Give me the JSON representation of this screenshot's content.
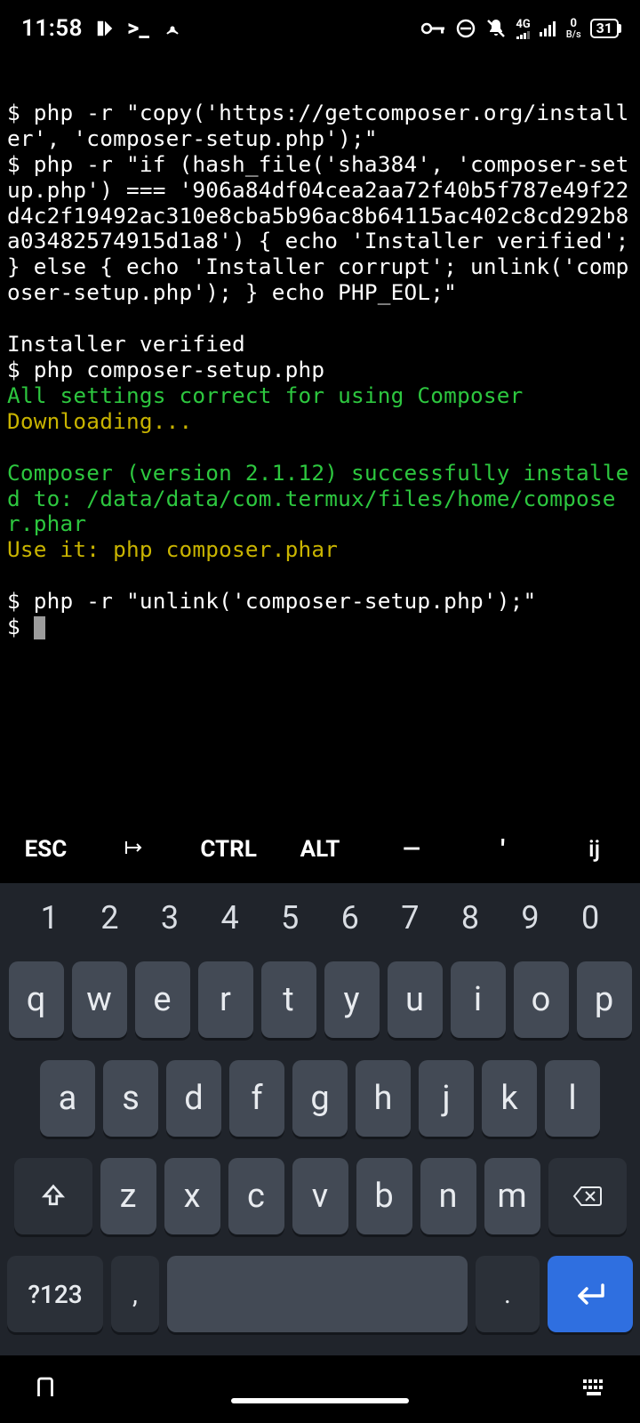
{
  "status": {
    "clock": "11:58",
    "net_label_top": "4G",
    "speed_top": "0",
    "speed_bot": "B/s",
    "battery": "31"
  },
  "term": {
    "l1": "$ php -r \"copy('https://getcomposer.org/installer', 'composer-setup.php');\"",
    "l2": "$ php -r \"if (hash_file('sha384', 'composer-setup.php') === '906a84df04cea2aa72f40b5f787e49f22d4c2f19492ac310e8cba5b96ac8b64115ac402c8cd292b8a03482574915d1a8') { echo 'Installer verified'; } else { echo 'Installer corrupt'; unlink('composer-setup.php'); } echo PHP_EOL;\"",
    "l3": "",
    "l4": "Installer verified",
    "l5": "$ php composer-setup.php",
    "l6": "All settings correct for using Composer",
    "l7": "Downloading...",
    "l8": "",
    "l9": "Composer (version 2.1.12) successfully installed to: /data/data/com.termux/files/home/composer.phar",
    "l10": "Use it: php composer.phar",
    "l11": "",
    "l12": "$ php -r \"unlink('composer-setup.php');\"",
    "l13": "$ "
  },
  "extra": {
    "esc": "ESC",
    "tab": "⇥",
    "ctrl": "CTRL",
    "alt": "ALT",
    "dash": "—",
    "apos": "'",
    "ij": "ij"
  },
  "kbd": {
    "nums": [
      "1",
      "2",
      "3",
      "4",
      "5",
      "6",
      "7",
      "8",
      "9",
      "0"
    ],
    "row1": [
      "q",
      "w",
      "e",
      "r",
      "t",
      "y",
      "u",
      "i",
      "o",
      "p"
    ],
    "row2": [
      "a",
      "s",
      "d",
      "f",
      "g",
      "h",
      "j",
      "k",
      "l"
    ],
    "row3": [
      "z",
      "x",
      "c",
      "v",
      "b",
      "n",
      "m"
    ],
    "sym": "?123",
    "comma": ",",
    "period": "."
  }
}
